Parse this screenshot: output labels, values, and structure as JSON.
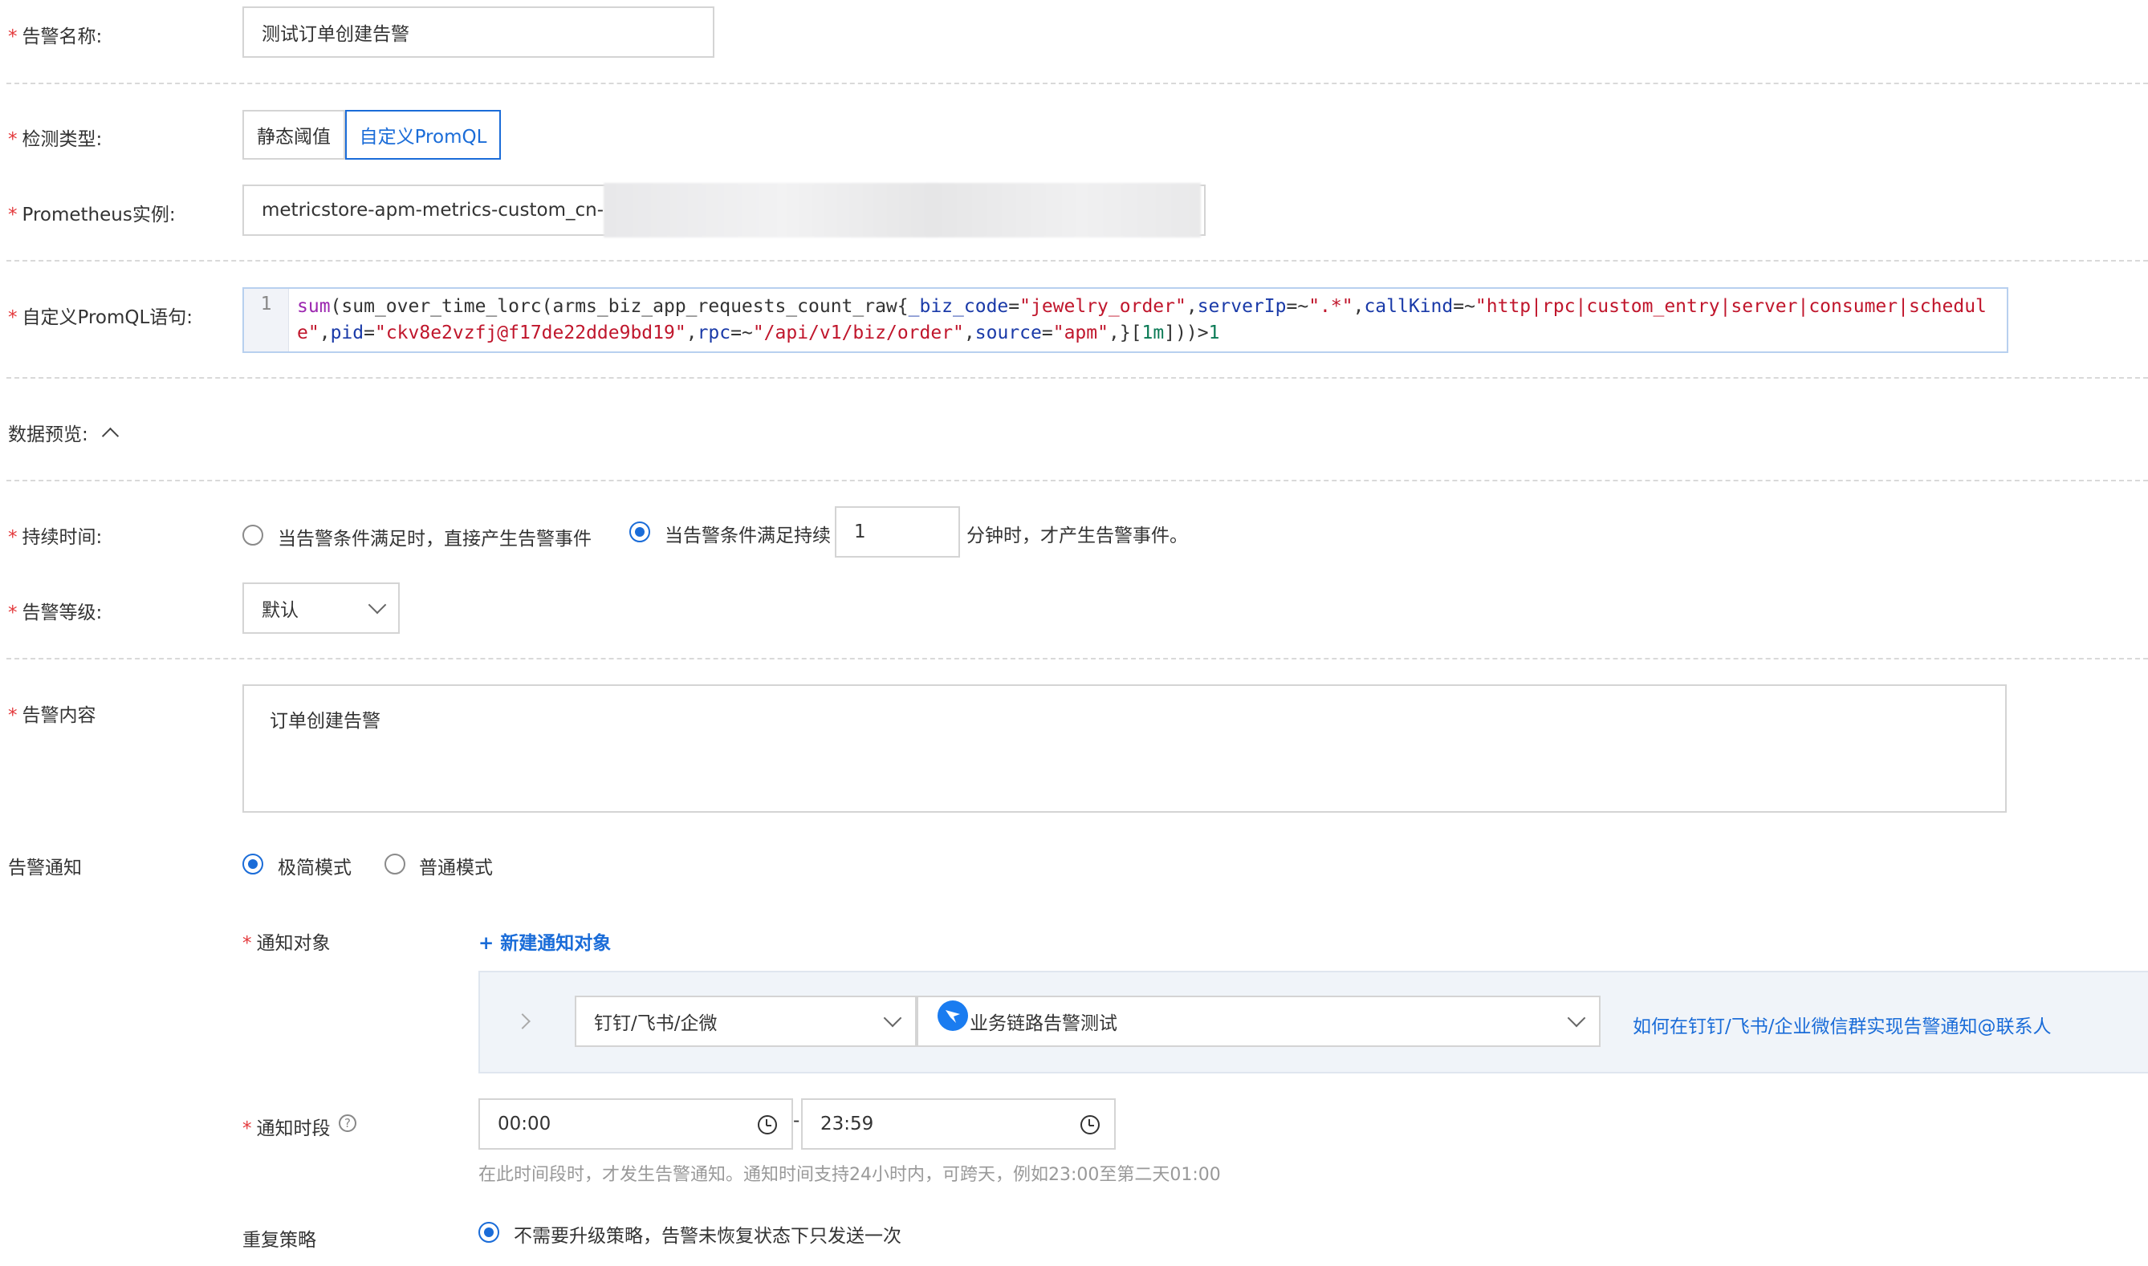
{
  "alert_name": {
    "label": "告警名称:",
    "value": "测试订单创建告警"
  },
  "detect_type": {
    "label": "检测类型:",
    "options": [
      "静态阈值",
      "自定义PromQL"
    ],
    "selected": "自定义PromQL"
  },
  "prometheus": {
    "label": "Prometheus实例:",
    "value": "metricstore-apm-metrics-custom_cn-"
  },
  "promql": {
    "label": "自定义PromQL语句:",
    "line_number": "1",
    "tokens": {
      "t1": "sum",
      "t2": "(",
      "t3": "sum_over_time_lorc",
      "t4": "(",
      "t5": "arms_biz_app_requests_count_raw",
      "t6": "{",
      "t7": "_biz_code",
      "t8": "=",
      "t9": "\"jewelry_order\"",
      "t10": ",",
      "t11": "serverIp",
      "t12": "=~",
      "t13": "\".*\"",
      "t14": ",",
      "t15": "callKind",
      "t16": "=~",
      "t17": "\"http|rpc|custom_entry|server|consumer|schedule\"",
      "t18": ",",
      "t19": "pid",
      "t20": "=",
      "t21": "\"ckv8e2vzfj@f17de22dde9bd19\"",
      "t22": ",",
      "t23": "rpc",
      "t24": "=~",
      "t25": "\"/api/v1/biz/order\"",
      "t26": ",",
      "t27": "source",
      "t28": "=",
      "t29": "\"apm\"",
      "t30": ",}[",
      "t31": "1m",
      "t32": "]))>",
      "t33": "1"
    }
  },
  "data_preview": {
    "label": "数据预览:"
  },
  "duration": {
    "label": "持续时间:",
    "option_immediate": "当告警条件满足时，直接产生告警事件",
    "option_sustained_prefix": "当告警条件满足持续",
    "minutes": "1",
    "option_sustained_suffix": "分钟时，才产生告警事件。",
    "selected": "sustained"
  },
  "level": {
    "label": "告警等级:",
    "value": "默认"
  },
  "content": {
    "label": "告警内容",
    "value": "订单创建告警"
  },
  "notify": {
    "label": "告警通知",
    "modes": [
      "极简模式",
      "普通模式"
    ],
    "selected_mode": "极简模式",
    "target_label": "通知对象",
    "new_target": "+ 新建通知对象",
    "channel": "钉钉/飞书/企微",
    "group": "业务链路告警测试",
    "help_link": "如何在钉钉/飞书/企业微信群实现告警通知@联系人",
    "period_label": "通知时段",
    "start": "00:00",
    "sep": "-",
    "end": "23:59",
    "period_hint": "在此时间段时，才发生告警通知。通知时间支持24小时内，可跨天，例如23:00至第二天01:00",
    "repeat_label": "重复策略",
    "repeat_option": "不需要升级策略，告警未恢复状态下只发送一次"
  },
  "colors": {
    "primary": "#1a6cd8",
    "required": "#e4393c",
    "border": "#d4d4d4"
  }
}
